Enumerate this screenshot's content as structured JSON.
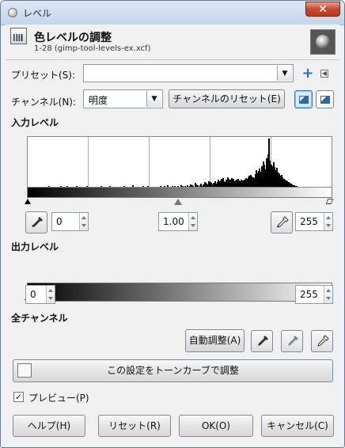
{
  "window": {
    "title": "レベル",
    "close_symbol": "✕"
  },
  "header": {
    "title": "色レベルの調整",
    "subtitle": "1-28 (gimp-tool-levels-ex.xcf)"
  },
  "preset": {
    "label": "プリセット(S):",
    "value": ""
  },
  "channel": {
    "label": "チャンネル(N):",
    "selected": "明度",
    "reset_label": "チャンネルのリセット(E)"
  },
  "input_levels": {
    "title": "入力レベル",
    "black_value": "0",
    "gamma_value": "1.00",
    "white_value": "255",
    "histogram": [
      0,
      0,
      0,
      0,
      0,
      0,
      0,
      0,
      0,
      0,
      0,
      0,
      0,
      0,
      0,
      0,
      0,
      0,
      1,
      0,
      0,
      0,
      0,
      0,
      0,
      0,
      0,
      0,
      1,
      0,
      0,
      0,
      0,
      0,
      1,
      0,
      0,
      0,
      0,
      0,
      0,
      0,
      1,
      0,
      0,
      0,
      0,
      0,
      0,
      0,
      0,
      1,
      0,
      0,
      0,
      0,
      0,
      0,
      0,
      0,
      0,
      0,
      0,
      1,
      0,
      0,
      0,
      0,
      0,
      0,
      0,
      1,
      0,
      0,
      0,
      0,
      0,
      0,
      0,
      0,
      0,
      0,
      0,
      1,
      0,
      0,
      0,
      0,
      0,
      0,
      0,
      2,
      0,
      0,
      0,
      0,
      0,
      0,
      0,
      0,
      1,
      0,
      0,
      0,
      1,
      0,
      0,
      0,
      0,
      0,
      0,
      0,
      0,
      0,
      0,
      1,
      0,
      0,
      1,
      0,
      0,
      2,
      0,
      0,
      0,
      1,
      0,
      1,
      0,
      0,
      1,
      0,
      0,
      2,
      1,
      0,
      1,
      0,
      2,
      0,
      1,
      3,
      2,
      1,
      0,
      5,
      3,
      2,
      0,
      2,
      4,
      1,
      3,
      6,
      5,
      4,
      3,
      7,
      6,
      5,
      3,
      5,
      7,
      4,
      6,
      9,
      7,
      8,
      10,
      11,
      7,
      6,
      9,
      12,
      10,
      9,
      8,
      11,
      10,
      7,
      8,
      9,
      10,
      8,
      7,
      9,
      8,
      6,
      9,
      11,
      10,
      12,
      14,
      15,
      13,
      12,
      11,
      16,
      21,
      18,
      20,
      23,
      19,
      26,
      31,
      28,
      22,
      35,
      40,
      60,
      32,
      28,
      26,
      30,
      25,
      21,
      24,
      18,
      16,
      14,
      15,
      12,
      10,
      9,
      8,
      7,
      6,
      5,
      4,
      3,
      2,
      2,
      1,
      1,
      0,
      0,
      0,
      0,
      0,
      0,
      0,
      0,
      0,
      0,
      0,
      0,
      0,
      0,
      0,
      0,
      0,
      0,
      0,
      0,
      0,
      0,
      0,
      0,
      0,
      0,
      0,
      0,
      0,
      0
    ]
  },
  "output_levels": {
    "title": "出力レベル",
    "black_value": "0",
    "white_value": "255"
  },
  "all_channels": {
    "title": "全チャンネル",
    "auto_label": "自動調整(A)"
  },
  "curve_button": {
    "label": "この設定をトーンカーブで調整"
  },
  "preview": {
    "label": "プレビュー(P)",
    "checked_symbol": "✓"
  },
  "buttons": {
    "help": "ヘルプ(H)",
    "reset": "リセット(R)",
    "ok": "OK(O)",
    "cancel": "キャンセル(C)"
  },
  "colors": {
    "accent": "#2b6fc2",
    "window_border": "#6b7c8e",
    "panel": "#f0f0f0"
  }
}
